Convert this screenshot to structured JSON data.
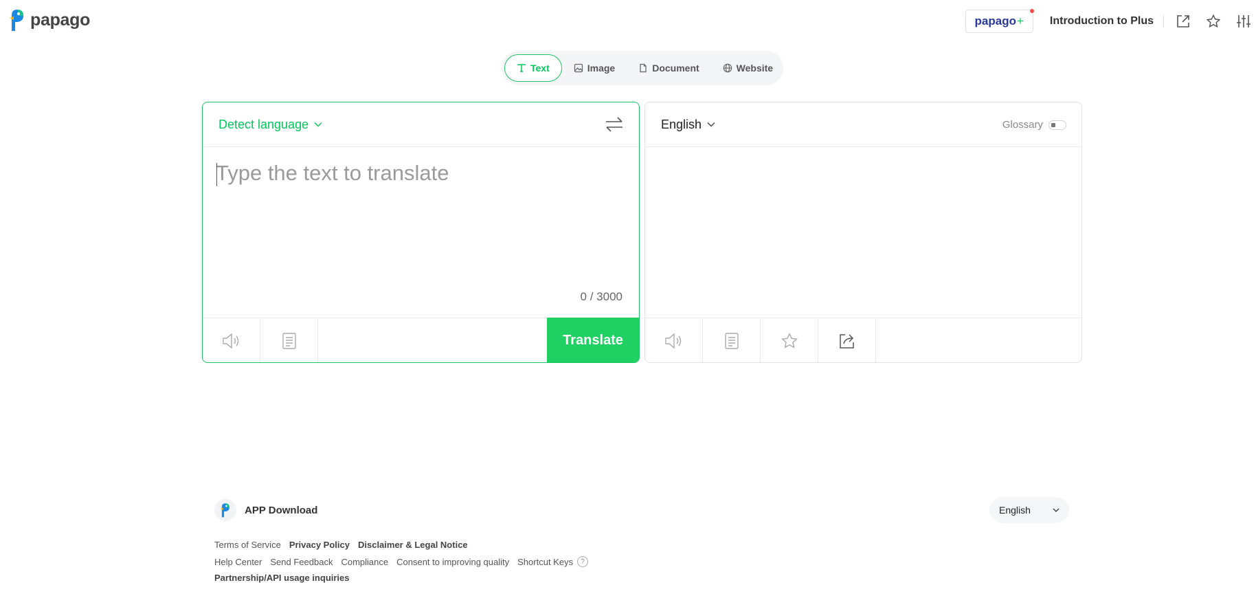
{
  "header": {
    "logo_text": "papago",
    "plus_badge": {
      "name": "papago",
      "suffix": "+"
    },
    "intro_link": "Introduction to Plus",
    "icons": [
      "open-new-window-icon",
      "favorites-star-icon",
      "settings-sliders-icon"
    ]
  },
  "tabs": [
    {
      "label": "Text",
      "icon": "text-icon",
      "active": true
    },
    {
      "label": "Image",
      "icon": "image-icon",
      "active": false
    },
    {
      "label": "Document",
      "icon": "document-icon",
      "active": false
    },
    {
      "label": "Website",
      "icon": "globe-icon",
      "active": false
    }
  ],
  "source": {
    "language": "Detect language",
    "placeholder": "Type the text to translate",
    "value": "",
    "counter": "0 / 3000",
    "translate_label": "Translate"
  },
  "target": {
    "language": "English",
    "glossary_label": "Glossary",
    "glossary_enabled": false
  },
  "footer": {
    "app_download": "APP Download",
    "language_select": "English",
    "links_row1": [
      "Terms of Service",
      "Privacy Policy",
      "Disclaimer & Legal Notice"
    ],
    "links_row2": [
      "Help Center",
      "Send Feedback",
      "Compliance",
      "Consent to improving quality",
      "Shortcut Keys"
    ],
    "help_mark": "?",
    "links_row3": [
      "Partnership/API usage inquiries"
    ]
  },
  "colors": {
    "accent": "#03c75a",
    "translate_button": "#1fd163",
    "plus_brand": "#2a3a9c",
    "notification_dot": "#ff4848"
  }
}
